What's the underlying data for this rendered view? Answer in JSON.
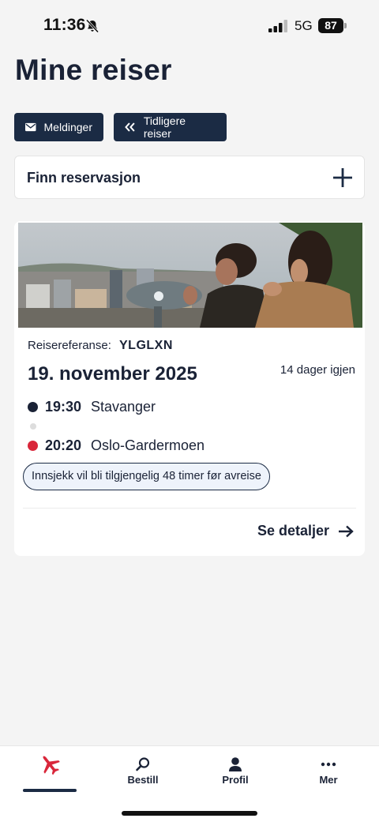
{
  "status_bar": {
    "time": "11:36",
    "network": "5G",
    "battery": "87",
    "icons": [
      "bell-off-icon",
      "signal-icon",
      "battery-icon"
    ]
  },
  "page_title": "Mine reiser",
  "actions": {
    "messages_label": "Meldinger",
    "previous_trips_label": "Tidligere reiser"
  },
  "find_reservation": {
    "label": "Finn reservasjon"
  },
  "trip": {
    "reference_label": "Reisereferanse:",
    "reference_value": "YLGLXN",
    "date": "19. november 2025",
    "days_left": "14 dager igjen",
    "departure": {
      "time": "19:30",
      "city": "Stavanger"
    },
    "arrival": {
      "time": "20:20",
      "city": "Oslo-Gardermoen"
    },
    "checkin_note": "Innsjekk vil bli tilgjengelig 48 timer før avreise",
    "details_label": "Se detaljer"
  },
  "bottom_nav": {
    "items": [
      {
        "label": "",
        "icon": "plane-icon",
        "active": true
      },
      {
        "label": "Bestill",
        "icon": "search-icon"
      },
      {
        "label": "Profil",
        "icon": "profile-icon"
      },
      {
        "label": "Mer",
        "icon": "more-icon"
      }
    ]
  },
  "colors": {
    "navy": "#1b2b44",
    "accent_red": "#d9263a",
    "background": "#f4f4f4"
  }
}
